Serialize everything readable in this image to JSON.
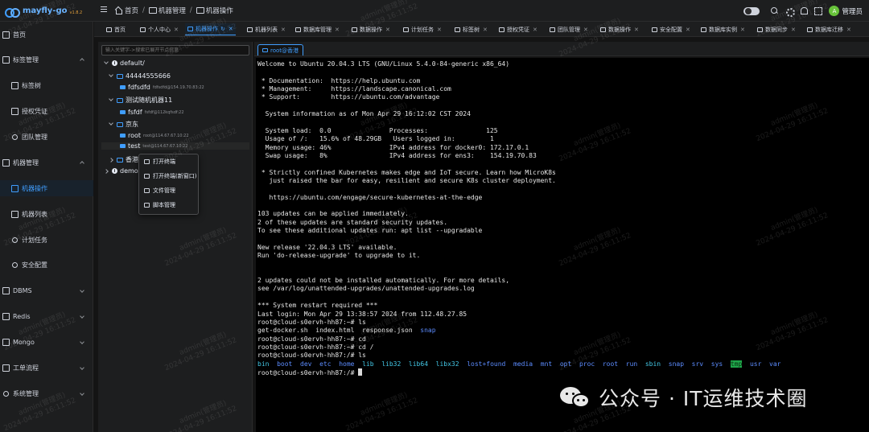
{
  "header": {
    "logo_text": "mayfly-go",
    "logo_version": "v1.8.2",
    "breadcrumb": [
      "首页",
      "机器管理",
      "机器操作"
    ],
    "username": "管理员",
    "avatar_letter": "A"
  },
  "sidebar": {
    "items": [
      {
        "label": "首页",
        "level": "top"
      },
      {
        "label": "标签管理",
        "level": "top",
        "expanded": true
      },
      {
        "label": "标签树",
        "level": "sub"
      },
      {
        "label": "授权凭证",
        "level": "sub"
      },
      {
        "label": "团队管理",
        "level": "sub"
      },
      {
        "label": "机器管理",
        "level": "top",
        "expanded": true
      },
      {
        "label": "机器操作",
        "level": "sub",
        "active": true
      },
      {
        "label": "机器列表",
        "level": "sub"
      },
      {
        "label": "计划任务",
        "level": "sub"
      },
      {
        "label": "安全配置",
        "level": "sub"
      },
      {
        "label": "DBMS",
        "level": "top"
      },
      {
        "label": "Redis",
        "level": "top"
      },
      {
        "label": "Mongo",
        "level": "top"
      },
      {
        "label": "工单流程",
        "level": "top"
      },
      {
        "label": "系统管理",
        "level": "top"
      }
    ]
  },
  "tabs": [
    "首页",
    "个人中心",
    "机器操作",
    "机器列表",
    "数据库管理",
    "数据操作",
    "计划任务",
    "标签树",
    "授权凭证",
    "团队管理",
    "数据操作",
    "安全配置",
    "数据库实例",
    "数据同步",
    "数据库迁移"
  ],
  "tree": {
    "search_placeholder": "输入关键字->搜索已展开节点信息",
    "nodes": [
      {
        "label": "default/",
        "type": "root"
      },
      {
        "label": "44444555666",
        "type": "group"
      },
      {
        "label": "fdfsdfd",
        "host": "fdfsdfd@154.19.70.83:22",
        "type": "leaf"
      },
      {
        "label": "测试随机机器11",
        "type": "group"
      },
      {
        "label": "fsfdf",
        "host": "fsfdf@112kqfsdf:22",
        "type": "leaf"
      },
      {
        "label": "京东",
        "type": "group"
      },
      {
        "label": "root",
        "host": "root@114.67.67.10:22",
        "type": "leaf"
      },
      {
        "label": "test",
        "host": "test@114.67.67.10:22",
        "type": "leaf"
      },
      {
        "label": "香港",
        "type": "group"
      },
      {
        "label": "demo",
        "type": "root"
      }
    ]
  },
  "context_menu": [
    "打开终端",
    "打开终端(新窗口)",
    "文件管理",
    "脚本管理"
  ],
  "terminal": {
    "tab_label": "root@香港",
    "lines": [
      "Welcome to Ubuntu 20.04.3 LTS (GNU/Linux 5.4.0-84-generic x86_64)",
      "",
      " * Documentation:  https://help.ubuntu.com",
      " * Management:     https://landscape.canonical.com",
      " * Support:        https://ubuntu.com/advantage",
      "",
      "  System information as of Mon Apr 29 16:12:02 CST 2024",
      "",
      "  System load:  0.0               Processes:               125",
      "  Usage of /:   15.6% of 48.29GB   Users logged in:         1",
      "  Memory usage: 46%               IPv4 address for docker0: 172.17.0.1",
      "  Swap usage:   8%                IPv4 address for ens3:    154.19.70.83",
      "",
      " * Strictly confined Kubernetes makes edge and IoT secure. Learn how MicroK8s",
      "   just raised the bar for easy, resilient and secure K8s cluster deployment.",
      "",
      "   https://ubuntu.com/engage/secure-kubernetes-at-the-edge",
      "",
      "103 updates can be applied immediately.",
      "2 of these updates are standard security updates.",
      "To see these additional updates run: apt list --upgradable",
      "",
      "New release '22.04.3 LTS' available.",
      "Run 'do-release-upgrade' to upgrade to it.",
      "",
      "",
      "2 updates could not be installed automatically. For more details,",
      "see /var/log/unattended-upgrades/unattended-upgrades.log",
      "",
      "*** System restart required ***",
      "Last login: Mon Apr 29 13:38:57 2024 from 112.48.27.85",
      "root@cloud-s0ervh-hh87:~# ls",
      "get-docker.sh  index.html  response.json  ",
      "root@cloud-s0ervh-hh87:~# cd",
      "root@cloud-s0ervh-hh87:~# cd /",
      "root@cloud-s0ervh-hh87:/# ls",
      "",
      "root@cloud-s0ervh-hh87:/# "
    ],
    "ls_root_dirs": [
      "bin",
      "boot",
      "dev",
      "etc",
      "home",
      "lib",
      "lib32",
      "lib64",
      "libx32",
      "lost+found",
      "media",
      "mnt",
      "opt",
      "proc",
      "root",
      "run",
      "sbin",
      "snap",
      "srv",
      "sys",
      "tmp",
      "usr",
      "var"
    ],
    "snap_dir": "snap"
  },
  "watermark": {
    "line1": "admin(管理员)",
    "line2": "2024-04-29 16:11:52"
  },
  "branding": {
    "text": "公众号 · IT运维技术圈"
  }
}
